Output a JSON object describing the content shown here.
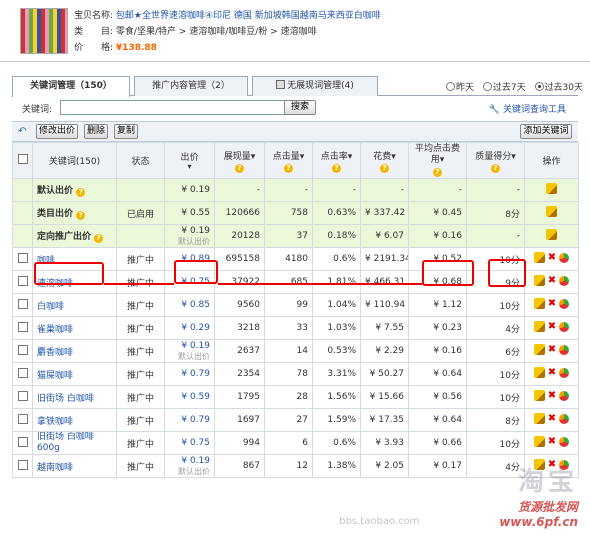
{
  "product": {
    "name_label": "宝贝名称:",
    "name": "包邮★全世界速溶咖啡④印尼 德国 新加坡韩国越南马来西亚白咖啡",
    "category_label": "类　　目:",
    "category": "零食/坚果/特产 > 速溶咖啡/咖啡豆/粉 > 速溶咖啡",
    "price_label": "价　　格:",
    "price": "¥138.88"
  },
  "tabs": [
    {
      "label": "关键词管理（150）"
    },
    {
      "label": "推广内容管理（2）"
    },
    {
      "label": "无展现词管理(4)"
    }
  ],
  "time_range": {
    "options": [
      "昨天",
      "过去7天",
      "过去30天"
    ],
    "selected": "过去30天"
  },
  "search": {
    "label": "关键词:",
    "value": "",
    "placeholder": "",
    "button": "搜索",
    "tool_link": "关键词查询工具"
  },
  "actions": {
    "edit_bid": "修改出价",
    "delete": "删除",
    "copy": "复制",
    "add_keyword": "添加关键词"
  },
  "table": {
    "headers": [
      "关键词(150)",
      "状态",
      "出价",
      "展现量",
      "点击量",
      "点击率",
      "花费",
      "平均点击费用",
      "质量得分",
      "操作"
    ],
    "default_label": "默认出价",
    "system_rows": [
      {
        "name": "默认出价",
        "status": "",
        "bid": "¥ 0.19",
        "bid_default": "",
        "impr": "-",
        "clicks": "-",
        "ctr": "-",
        "cost": "-",
        "avg": "-",
        "quality": "-"
      },
      {
        "name": "类目出价",
        "status": "已启用",
        "bid": "¥ 0.55",
        "bid_default": "",
        "impr": "120666",
        "clicks": "758",
        "ctr": "0.63%",
        "cost": "¥ 337.42",
        "avg": "¥ 0.45",
        "quality": "8分"
      },
      {
        "name": "定向推广出价",
        "status": "",
        "bid": "¥ 0.19",
        "bid_default": "默认出价",
        "impr": "20128",
        "clicks": "37",
        "ctr": "0.18%",
        "cost": "¥ 6.07",
        "avg": "¥ 0.16",
        "quality": "-"
      }
    ],
    "rows": [
      {
        "keyword": "咖啡",
        "status": "推广中",
        "bid": "¥ 0.89",
        "bid_default": "",
        "impr": "695158",
        "clicks": "4180",
        "ctr": "0.6%",
        "cost": "¥ 2191.34",
        "avg": "¥ 0.52",
        "quality": "10分"
      },
      {
        "keyword": "速溶咖啡",
        "status": "推广中",
        "bid": "¥ 0.75",
        "bid_default": "",
        "impr": "37922",
        "clicks": "685",
        "ctr": "1.81%",
        "cost": "¥ 466.31",
        "avg": "¥ 0.68",
        "quality": "9分"
      },
      {
        "keyword": "白咖啡",
        "status": "推广中",
        "bid": "¥ 0.85",
        "bid_default": "",
        "impr": "9560",
        "clicks": "99",
        "ctr": "1.04%",
        "cost": "¥ 110.94",
        "avg": "¥ 1.12",
        "quality": "10分"
      },
      {
        "keyword": "雀巢咖啡",
        "status": "推广中",
        "bid": "¥ 0.29",
        "bid_default": "",
        "impr": "3218",
        "clicks": "33",
        "ctr": "1.03%",
        "cost": "¥ 7.55",
        "avg": "¥ 0.23",
        "quality": "4分"
      },
      {
        "keyword": "麝香咖啡",
        "status": "推广中",
        "bid": "¥ 0.19",
        "bid_default": "默认出价",
        "impr": "2637",
        "clicks": "14",
        "ctr": "0.53%",
        "cost": "¥ 2.29",
        "avg": "¥ 0.16",
        "quality": "6分"
      },
      {
        "keyword": "猫屎咖啡",
        "status": "推广中",
        "bid": "¥ 0.79",
        "bid_default": "",
        "impr": "2354",
        "clicks": "78",
        "ctr": "3.31%",
        "cost": "¥ 50.27",
        "avg": "¥ 0.64",
        "quality": "10分"
      },
      {
        "keyword": "旧街场 白咖啡",
        "status": "推广中",
        "bid": "¥ 0.59",
        "bid_default": "",
        "impr": "1795",
        "clicks": "28",
        "ctr": "1.56%",
        "cost": "¥ 15.66",
        "avg": "¥ 0.56",
        "quality": "10分"
      },
      {
        "keyword": "拿铁咖啡",
        "status": "推广中",
        "bid": "¥ 0.79",
        "bid_default": "",
        "impr": "1697",
        "clicks": "27",
        "ctr": "1.59%",
        "cost": "¥ 17.35",
        "avg": "¥ 0.64",
        "quality": "8分"
      },
      {
        "keyword": "旧街场 白咖啡 600g",
        "status": "推广中",
        "bid": "¥ 0.75",
        "bid_default": "",
        "impr": "994",
        "clicks": "6",
        "ctr": "0.6%",
        "cost": "¥ 3.93",
        "avg": "¥ 0.66",
        "quality": "10分"
      },
      {
        "keyword": "越南咖啡",
        "status": "推广中",
        "bid": "¥ 0.19",
        "bid_default": "默认出价",
        "impr": "867",
        "clicks": "12",
        "ctr": "1.38%",
        "cost": "¥ 2.05",
        "avg": "¥ 0.17",
        "quality": "4分"
      }
    ]
  },
  "watermark": {
    "big": "淘宝",
    "site1": "货源批发网",
    "site2": "www.6pf.cn",
    "bbs": "bbs.taobao.com"
  },
  "colors": {
    "link": "#2255aa",
    "price": "#ff6600",
    "system_row_bg": "#eaf7d9",
    "annotation": "#e00000"
  }
}
